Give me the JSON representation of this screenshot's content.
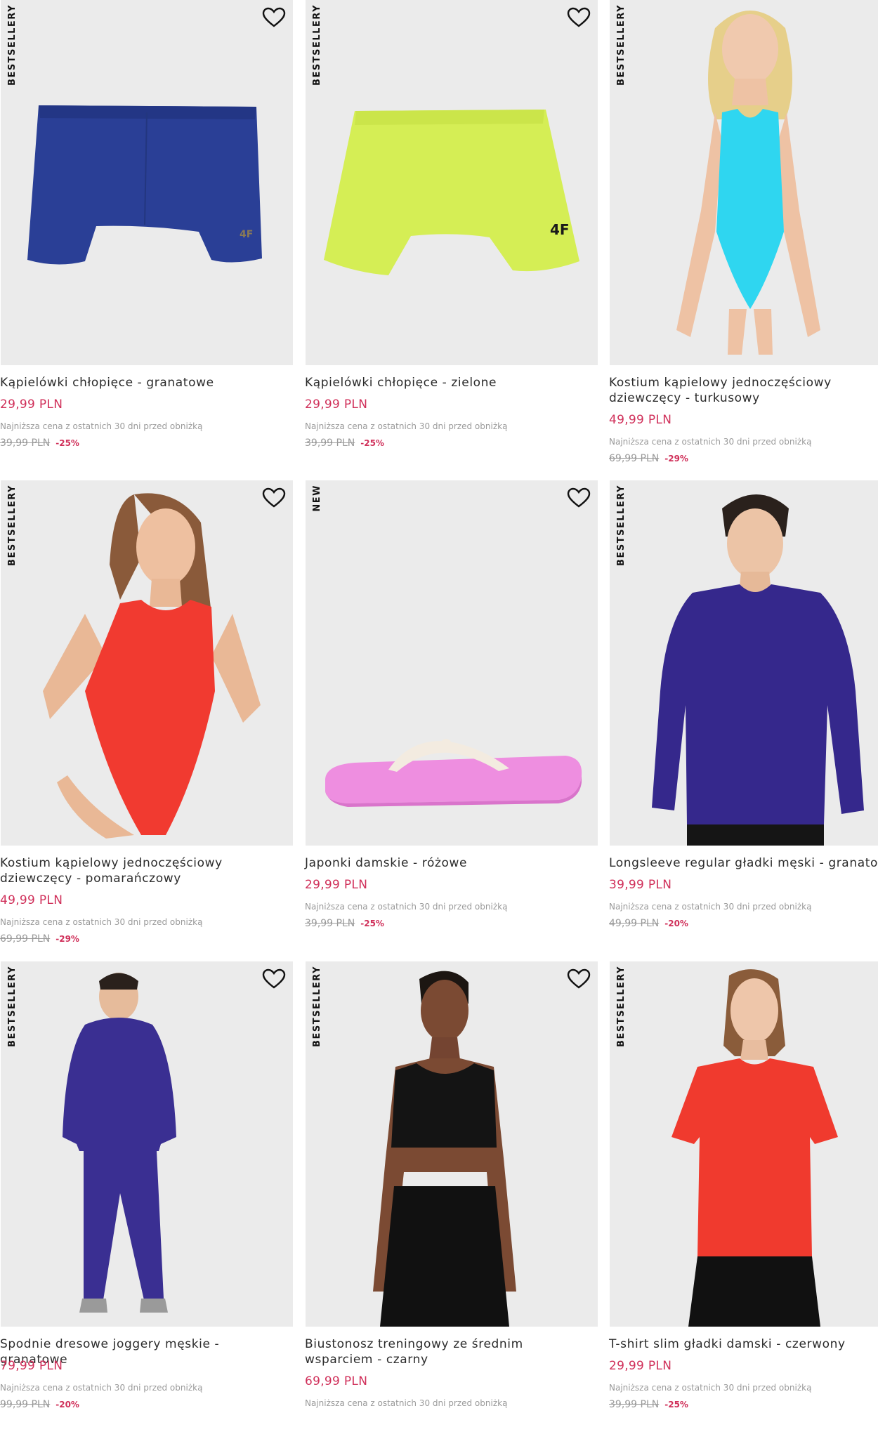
{
  "products": [
    {
      "badge": "BESTSELLERY",
      "title": "Kąpielówki chłopięce - granatowe",
      "price": "29,99 PLN",
      "lowest": "Najniższa cena z ostatnich 30 dni przed obniżką",
      "old_price": "39,99 PLN",
      "discount": "-25%",
      "image": "navy-swim-trunks"
    },
    {
      "badge": "BESTSELLERY",
      "title": "Kąpielówki chłopięce - zielone",
      "price": "29,99 PLN",
      "lowest": "Najniższa cena z ostatnich 30 dni przed obniżką",
      "old_price": "39,99 PLN",
      "discount": "-25%",
      "image": "green-swim-trunks"
    },
    {
      "badge": "BESTSELLERY",
      "title": "Kostium kąpielowy jednoczęściowy dziewczęcy - turkusowy",
      "price": "49,99 PLN",
      "lowest": "Najniższa cena z ostatnich 30 dni przed obniżką",
      "old_price": "69,99 PLN",
      "discount": "-29%",
      "image": "turquoise-swimsuit-girl"
    },
    {
      "badge": "BESTSELLERY",
      "title": "Kostium kąpielowy jednoczęściowy dziewczęcy - pomarańczowy",
      "price": "49,99 PLN",
      "lowest": "Najniższa cena z ostatnich 30 dni przed obniżką",
      "old_price": "69,99 PLN",
      "discount": "-29%",
      "image": "orange-swimsuit-girl"
    },
    {
      "badge": "NEW",
      "title": "Japonki damskie - różowe",
      "price": "29,99 PLN",
      "lowest": "Najniższa cena z ostatnich 30 dni przed obniżką",
      "old_price": "39,99 PLN",
      "discount": "-25%",
      "image": "pink-flip-flop"
    },
    {
      "badge": "BESTSELLERY",
      "title": "Longsleeve regular gładki męski - granatowy",
      "price": "39,99 PLN",
      "lowest": "Najniższa cena z ostatnich 30 dni przed obniżką",
      "old_price": "49,99 PLN",
      "discount": "-20%",
      "image": "navy-longsleeve-man"
    },
    {
      "badge": "BESTSELLERY",
      "title": "Spodnie dresowe joggery męskie - granatowe",
      "price": "79,99 PLN",
      "lowest": "Najniższa cena z ostatnich 30 dni przed obniżką",
      "old_price": "99,99 PLN",
      "discount": "-20%",
      "image": "navy-joggers-man"
    },
    {
      "badge": "BESTSELLERY",
      "title": "Biustonosz treningowy ze średnim wsparciem - czarny",
      "price": "69,99 PLN",
      "lowest": "Najniższa cena z ostatnich 30 dni przed obniżką",
      "old_price": "",
      "discount": "",
      "image": "black-sports-bra-woman"
    },
    {
      "badge": "BESTSELLERY",
      "title": "T-shirt slim gładki damski - czerwony",
      "price": "29,99 PLN",
      "lowest": "Najniższa cena z ostatnich 30 dni przed obniżką",
      "old_price": "39,99 PLN",
      "discount": "-25%",
      "image": "red-tshirt-woman"
    }
  ],
  "icons": {
    "wishlist": "heart-outline-icon"
  },
  "colors": {
    "price": "#d0305a",
    "tile_bg": "#ebebeb",
    "old_price": "#9a9a9a"
  }
}
